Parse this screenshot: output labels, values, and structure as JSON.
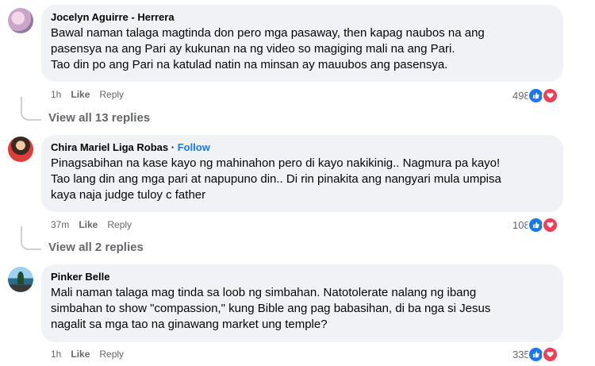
{
  "comments": [
    {
      "author": "Jocelyn Aguirre - Herrera",
      "text": "Bawal naman talaga magtinda don pero mga pasaway, then kapag naubos na ang\npasensya na ang Pari ay kukunan na ng video so magiging mali na ang Pari.\nTao din po ang Pari na katulad natin na minsan ay mauubos ang pasensya.",
      "time": "1h",
      "like_label": "Like",
      "reply_label": "Reply",
      "reaction_count": "498",
      "view_replies": "View all 13 replies"
    },
    {
      "author": "Chira Mariel Liga Robas",
      "separator": "·",
      "follow_label": "Follow",
      "text": "Pinagsabihan na kase kayo ng mahinahon pero di kayo nakikinig.. Nagmura pa kayo!\nTao lang din ang mga pari at napupuno din.. Di rin pinakita ang nangyari mula umpisa\nkaya naja judge tuloy c father",
      "time": "37m",
      "like_label": "Like",
      "reply_label": "Reply",
      "reaction_count": "108",
      "view_replies": "View all 2 replies"
    },
    {
      "author": "Pinker Belle",
      "text": "Mali naman talaga mag tinda sa loob ng simbahan. Natotolerate nalang ng ibang\nsimbahan to show \"compassion,\" kung Bible ang pag babasihan, di ba nga si Jesus\nnagalit sa mga tao na ginawang market ung temple?",
      "time": "1h",
      "like_label": "Like",
      "reply_label": "Reply",
      "reaction_count": "335"
    }
  ],
  "icons": {
    "like": "thumbs-up-icon",
    "love": "heart-icon"
  },
  "colors": {
    "link": "#1877f2",
    "like": "#1877f2",
    "love": "#f33e58",
    "bubble": "#f0f2f5",
    "meta": "#65676b"
  }
}
